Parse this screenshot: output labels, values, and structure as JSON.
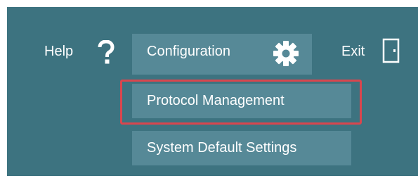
{
  "nav": {
    "help_label": "Help",
    "help_icon": "question-mark-icon",
    "configuration_label": "Configuration",
    "configuration_icon": "gear-icon",
    "exit_label": "Exit",
    "exit_icon": "door-exit-icon"
  },
  "dropdown": {
    "items": [
      {
        "label": "Protocol Management",
        "highlighted": true
      },
      {
        "label": "System Default Settings",
        "highlighted": false
      }
    ]
  },
  "colors": {
    "toolbar_background": "#3d7380",
    "menu_background": "#568997",
    "text": "#ffffff",
    "highlight_border": "#d9464e"
  }
}
